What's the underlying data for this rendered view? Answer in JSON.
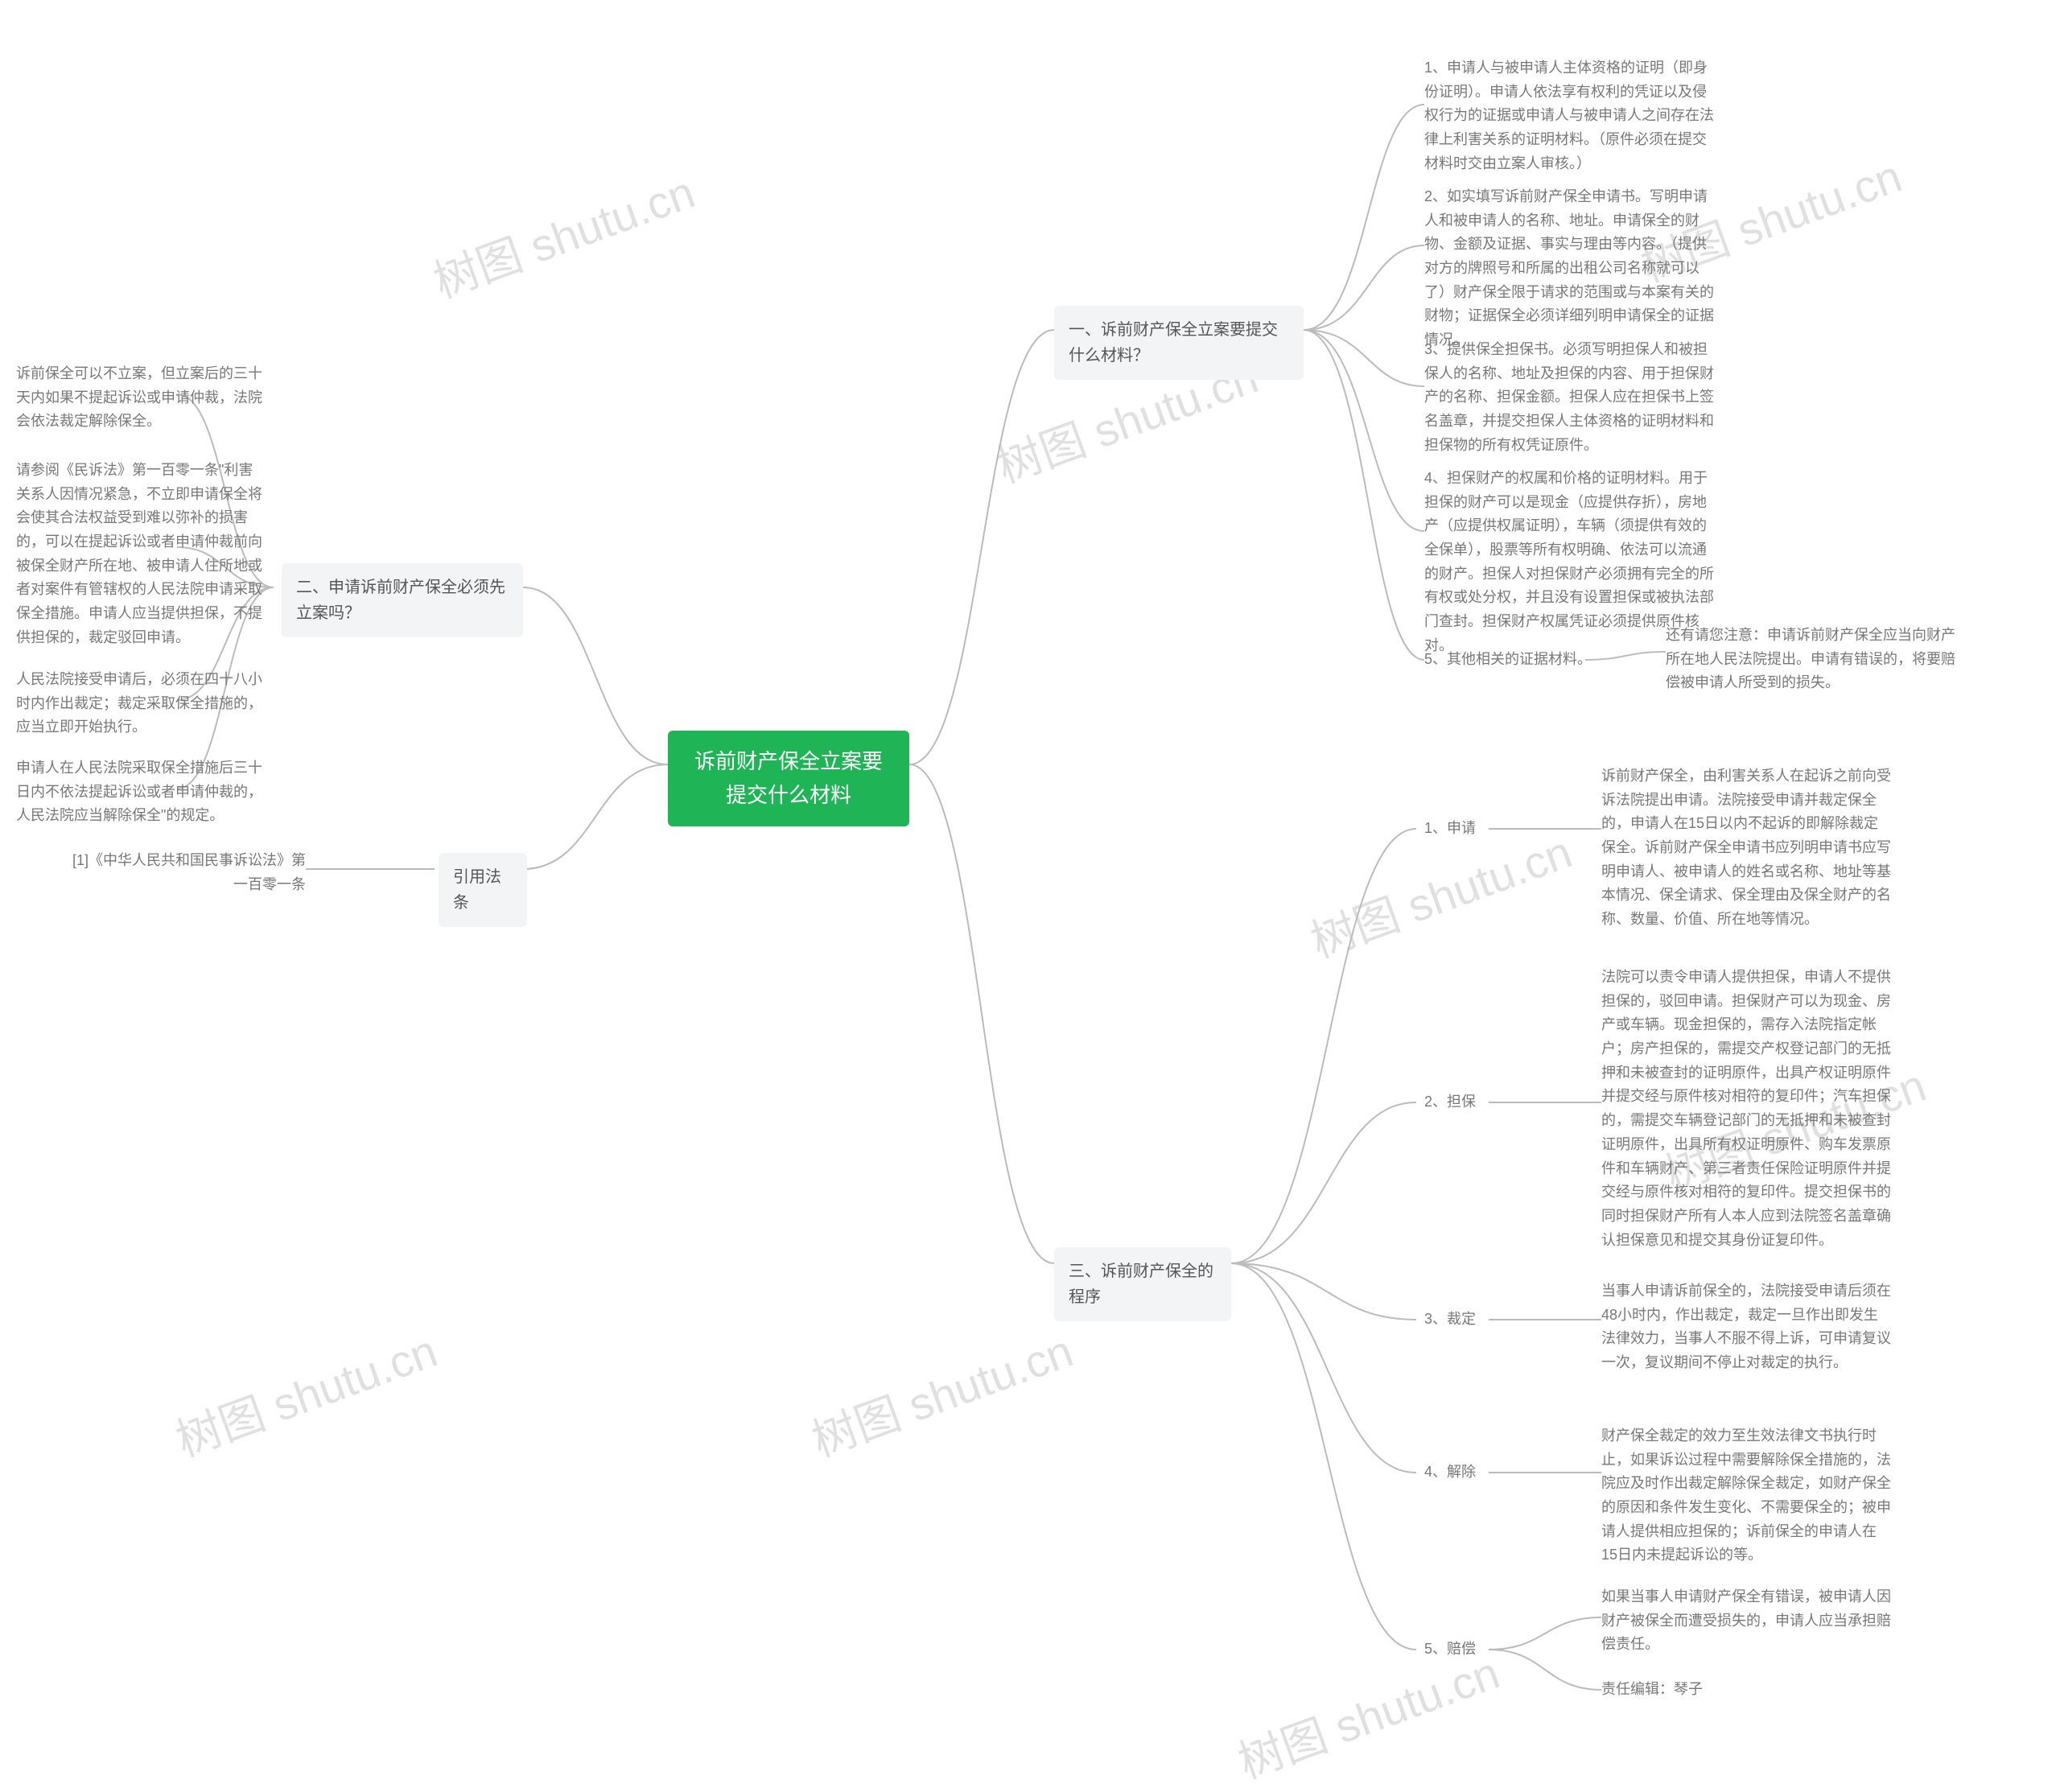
{
  "watermark": "树图 shutu.cn",
  "root": {
    "title": "诉前财产保全立案要提交什么材料"
  },
  "right": {
    "section1": {
      "title": "一、诉前财产保全立案要提交什么材料？",
      "items": [
        "1、申请人与被申请人主体资格的证明（即身份证明）。申请人依法享有权利的凭证以及侵权行为的证据或申请人与被申请人之间存在法律上利害关系的证明材料。（原件必须在提交材料时交由立案人审核。）",
        "2、如实填写诉前财产保全申请书。写明申请人和被申请人的名称、地址。申请保全的财物、金额及证据、事实与理由等内容。（提供对方的牌照号和所属的出租公司名称就可以了）财产保全限于请求的范围或与本案有关的财物；证据保全必须详细列明申请保全的证据情况。",
        "3、提供保全担保书。必须写明担保人和被担保人的名称、地址及担保的内容、用于担保财产的名称、担保金额。担保人应在担保书上签名盖章，并提交担保人主体资格的证明材料和担保物的所有权凭证原件。",
        "4、担保财产的权属和价格的证明材料。用于担保的财产可以是现金（应提供存折），房地产（应提供权属证明），车辆（须提供有效的全保单），股票等所有权明确、依法可以流通的财产。担保人对担保财产必须拥有完全的所有权或处分权，并且没有设置担保或被执法部门查封。担保财产权属凭证必须提供原件核对。",
        "5、其他相关的证据材料。"
      ],
      "note": "还有请您注意：申请诉前财产保全应当向财产所在地人民法院提出。申请有错误的，将要赔偿被申请人所受到的损失。"
    },
    "section3": {
      "title": "三、诉前财产保全的程序",
      "items": [
        {
          "label": "1、申请",
          "text": "诉前财产保全，由利害关系人在起诉之前向受诉法院提出申请。法院接受申请并裁定保全的，申请人在15日以内不起诉的即解除裁定保全。诉前财产保全申请书应列明申请书应写明申请人、被申请人的姓名或名称、地址等基本情况、保全请求、保全理由及保全财产的名称、数量、价值、所在地等情况。"
        },
        {
          "label": "2、担保",
          "text": "法院可以责令申请人提供担保，申请人不提供担保的，驳回申请。担保财产可以为现金、房产或车辆。现金担保的，需存入法院指定帐户；房产担保的，需提交产权登记部门的无抵押和未被查封的证明原件，出具产权证明原件并提交经与原件核对相符的复印件；汽车担保的，需提交车辆登记部门的无抵押和未被查封证明原件，出具所有权证明原件、购车发票原件和车辆财产、第三者责任保险证明原件并提交经与原件核对相符的复印件。提交担保书的同时担保财产所有人本人应到法院签名盖章确认担保意见和提交其身份证复印件。"
        },
        {
          "label": "3、裁定",
          "text": "当事人申请诉前保全的，法院接受申请后须在48小时内，作出裁定，裁定一旦作出即发生法律效力，当事人不服不得上诉，可申请复议一次，复议期间不停止对裁定的执行。"
        },
        {
          "label": "4、解除",
          "text": "财产保全裁定的效力至生效法律文书执行时止，如果诉讼过程中需要解除保全措施的，法院应及时作出裁定解除保全裁定，如财产保全的原因和条件发生变化、不需要保全的；被申请人提供相应担保的；诉前保全的申请人在15日内未提起诉讼的等。"
        },
        {
          "label": "5、赔偿",
          "text": "如果当事人申请财产保全有错误，被申请人因财产被保全而遭受损失的，申请人应当承担赔偿责任。"
        }
      ],
      "editor": "责任编辑：琴子"
    }
  },
  "left": {
    "section2": {
      "title": "二、申请诉前财产保全必须先立案吗？",
      "items": [
        "诉前保全可以不立案，但立案后的三十天内如果不提起诉讼或申请仲裁，法院会依法裁定解除保全。",
        "请参阅《民诉法》第一百零一条\"利害关系人因情况紧急，不立即申请保全将会使其合法权益受到难以弥补的损害的，可以在提起诉讼或者申请仲裁前向被保全财产所在地、被申请人住所地或者对案件有管辖权的人民法院申请采取保全措施。申请人应当提供担保，不提供担保的，裁定驳回申请。",
        "人民法院接受申请后，必须在四十八小时内作出裁定；裁定采取保全措施的，应当立即开始执行。",
        "申请人在人民法院采取保全措施后三十日内不依法提起诉讼或者申请仲裁的，人民法院应当解除保全\"的规定。"
      ]
    },
    "law": {
      "title": "引用法条",
      "items": [
        "[1]《中华人民共和国民事诉讼法》第一百零一条"
      ]
    }
  }
}
